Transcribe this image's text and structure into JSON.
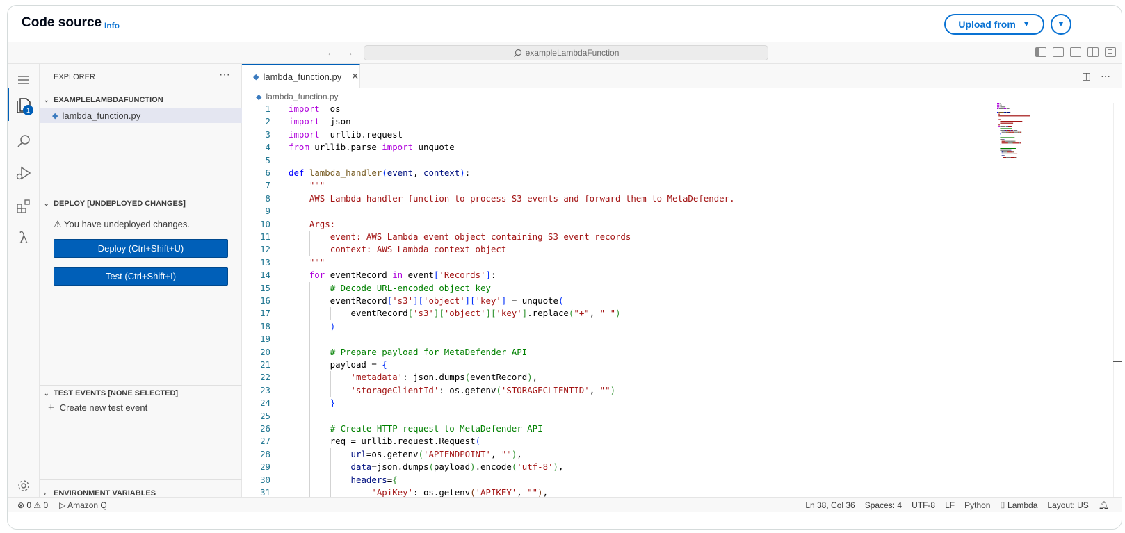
{
  "header": {
    "title": "Code source",
    "info": "Info",
    "upload_label": "Upload from"
  },
  "titlebar": {
    "search_text": "exampleLambdaFunction"
  },
  "activity": {
    "badge": "1"
  },
  "sidebar": {
    "title": "EXPLORER",
    "folder": "EXAMPLELAMBDAFUNCTION",
    "file": "lambda_function.py",
    "deploy_header": "DEPLOY [UNDEPLOYED CHANGES]",
    "deploy_warning": "You have undeployed changes.",
    "deploy_button": "Deploy (Ctrl+Shift+U)",
    "test_button": "Test (Ctrl+Shift+I)",
    "test_events_header": "TEST EVENTS [NONE SELECTED]",
    "create_test_event": "Create new test event",
    "env_vars_header": "ENVIRONMENT VARIABLES"
  },
  "editor": {
    "tab_label": "lambda_function.py",
    "breadcrumb": "lambda_function.py",
    "lines": [
      [
        [
          "kw",
          "import"
        ],
        [
          "",
          "  os"
        ]
      ],
      [
        [
          "kw",
          "import"
        ],
        [
          "",
          "  json"
        ]
      ],
      [
        [
          "kw",
          "import"
        ],
        [
          "",
          "  urllib.request"
        ]
      ],
      [
        [
          "kw",
          "from"
        ],
        [
          "",
          " urllib.parse "
        ],
        [
          "kw",
          "import"
        ],
        [
          "",
          " unquote"
        ]
      ],
      [],
      [
        [
          "kw2",
          "def"
        ],
        [
          "",
          " "
        ],
        [
          "fn",
          "lambda_handler"
        ],
        [
          "b1",
          "("
        ],
        [
          "pr",
          "event"
        ],
        [
          "",
          ", "
        ],
        [
          "pr",
          "context"
        ],
        [
          "b1",
          ")"
        ],
        [
          "",
          ":"
        ]
      ],
      [
        [
          "",
          "    "
        ],
        [
          "st",
          "\"\"\""
        ]
      ],
      [
        [
          "",
          "    "
        ],
        [
          "st",
          "AWS Lambda handler function to process S3 events and forward them to MetaDefender."
        ]
      ],
      [],
      [
        [
          "",
          "    "
        ],
        [
          "st",
          "Args:"
        ]
      ],
      [
        [
          "",
          "        "
        ],
        [
          "st",
          "event: AWS Lambda event object containing S3 event records"
        ]
      ],
      [
        [
          "",
          "        "
        ],
        [
          "st",
          "context: AWS Lambda context object"
        ]
      ],
      [
        [
          "",
          "    "
        ],
        [
          "st",
          "\"\"\""
        ]
      ],
      [
        [
          "",
          "    "
        ],
        [
          "kw",
          "for"
        ],
        [
          "",
          " eventRecord "
        ],
        [
          "kw",
          "in"
        ],
        [
          "",
          " event"
        ],
        [
          "b1",
          "["
        ],
        [
          "st",
          "'Records'"
        ],
        [
          "b1",
          "]"
        ],
        [
          "",
          ":"
        ]
      ],
      [
        [
          "",
          "        "
        ],
        [
          "cm",
          "# Decode URL-encoded object key"
        ]
      ],
      [
        [
          "",
          "        eventRecord"
        ],
        [
          "b1",
          "["
        ],
        [
          "st",
          "'s3'"
        ],
        [
          "b1",
          "]["
        ],
        [
          "st",
          "'object'"
        ],
        [
          "b1",
          "]["
        ],
        [
          "st",
          "'key'"
        ],
        [
          "b1",
          "]"
        ],
        [
          "",
          " = unquote"
        ],
        [
          "b1",
          "("
        ]
      ],
      [
        [
          "",
          "            eventRecord"
        ],
        [
          "b2",
          "["
        ],
        [
          "st",
          "'s3'"
        ],
        [
          "b2",
          "]["
        ],
        [
          "st",
          "'object'"
        ],
        [
          "b2",
          "]["
        ],
        [
          "st",
          "'key'"
        ],
        [
          "b2",
          "]"
        ],
        [
          "",
          ".replace"
        ],
        [
          "b2",
          "("
        ],
        [
          "st",
          "\"+\""
        ],
        [
          "",
          ", "
        ],
        [
          "st",
          "\" \""
        ],
        [
          "b2",
          ")"
        ]
      ],
      [
        [
          "",
          "        "
        ],
        [
          "b1",
          ")"
        ]
      ],
      [],
      [
        [
          "",
          "        "
        ],
        [
          "cm",
          "# Prepare payload for MetaDefender API"
        ]
      ],
      [
        [
          "",
          "        payload = "
        ],
        [
          "b1",
          "{"
        ]
      ],
      [
        [
          "",
          "            "
        ],
        [
          "st",
          "'metadata'"
        ],
        [
          "",
          ": json.dumps"
        ],
        [
          "b2",
          "("
        ],
        [
          "",
          "eventRecord"
        ],
        [
          "b2",
          ")"
        ],
        [
          "",
          ","
        ]
      ],
      [
        [
          "",
          "            "
        ],
        [
          "st",
          "'storageClientId'"
        ],
        [
          "",
          ": os.getenv"
        ],
        [
          "b2",
          "("
        ],
        [
          "st",
          "'STORAGECLIENTID'"
        ],
        [
          "",
          ", "
        ],
        [
          "st",
          "\"\""
        ],
        [
          "b2",
          ")"
        ]
      ],
      [
        [
          "",
          "        "
        ],
        [
          "b1",
          "}"
        ]
      ],
      [],
      [
        [
          "",
          "        "
        ],
        [
          "cm",
          "# Create HTTP request to MetaDefender API"
        ]
      ],
      [
        [
          "",
          "        req = urllib.request.Request"
        ],
        [
          "b1",
          "("
        ]
      ],
      [
        [
          "",
          "            "
        ],
        [
          "pr",
          "url"
        ],
        [
          "",
          "=os.getenv"
        ],
        [
          "b2",
          "("
        ],
        [
          "st",
          "'APIENDPOINT'"
        ],
        [
          "",
          ", "
        ],
        [
          "st",
          "\"\""
        ],
        [
          "b2",
          ")"
        ],
        [
          "",
          ","
        ]
      ],
      [
        [
          "",
          "            "
        ],
        [
          "pr",
          "data"
        ],
        [
          "",
          "=json.dumps"
        ],
        [
          "b2",
          "("
        ],
        [
          "",
          "payload"
        ],
        [
          "b2",
          ")"
        ],
        [
          "",
          ".encode"
        ],
        [
          "b2",
          "("
        ],
        [
          "st",
          "'utf-8'"
        ],
        [
          "b2",
          ")"
        ],
        [
          "",
          ","
        ]
      ],
      [
        [
          "",
          "            "
        ],
        [
          "pr",
          "headers"
        ],
        [
          "",
          "="
        ],
        [
          "b2",
          "{"
        ]
      ],
      [
        [
          "",
          "                "
        ],
        [
          "st",
          "'ApiKey'"
        ],
        [
          "",
          ": os.getenv"
        ],
        [
          "b3",
          "("
        ],
        [
          "st",
          "'APIKEY'"
        ],
        [
          "",
          ", "
        ],
        [
          "st",
          "\"\""
        ],
        [
          "b3",
          ")"
        ],
        [
          "",
          ","
        ]
      ]
    ]
  },
  "status": {
    "problems": "⊗ 0 ⚠ 0",
    "amazon_q": "Amazon Q",
    "position": "Ln 38, Col 36",
    "spaces": "Spaces: 4",
    "encoding": "UTF-8",
    "eol": "LF",
    "language": "Python",
    "lambda": "Lambda",
    "layout": "Layout: US"
  },
  "colors": {
    "accent": "#0972d3",
    "button": "#005fb8",
    "keyword": "#af00db",
    "string": "#a31515",
    "comment": "#008000"
  },
  "icons": [
    "hamburger-icon",
    "explorer-files-icon",
    "search-icon",
    "run-debug-icon",
    "extensions-icon",
    "lambda-icon",
    "settings-gear-icon",
    "python-file-icon",
    "split-editor-icon",
    "more-actions-icon",
    "bell-icon"
  ]
}
